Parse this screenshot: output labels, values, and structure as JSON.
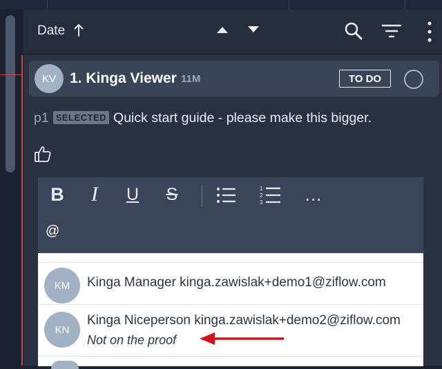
{
  "header": {
    "sort_label": "Date"
  },
  "comment": {
    "avatar_initials": "KV",
    "author": "1. Kinga Viewer",
    "time": "11M",
    "status": "TO DO",
    "page_ref": "p1",
    "selected_badge": "SELECTED",
    "text": "Quick start guide - please make this bigger."
  },
  "editor": {
    "bold_label": "B",
    "italic_label": "I",
    "underline_label": "U",
    "strike_label": "S",
    "more_label": "...",
    "input_value": "@"
  },
  "mentions": [
    {
      "initials": "KM",
      "text": "Kinga Manager kinga.zawislak+demo1@ziflow.com",
      "note": ""
    },
    {
      "initials": "KN",
      "text": "Kinga Niceperson kinga.zawislak+demo2@ziflow.com",
      "note": "Not on the proof"
    }
  ],
  "colors": {
    "background": "#1c2230",
    "panel": "#2a3242",
    "accent_red": "#d0121b",
    "avatar": "#a2b1c4"
  }
}
